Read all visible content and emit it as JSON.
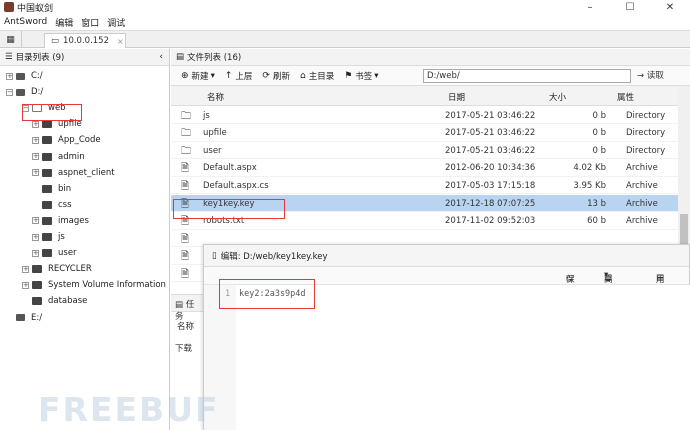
{
  "window": {
    "title": "中国蚁剑",
    "minimize": "–",
    "maximize": "☐",
    "close": "✕"
  },
  "menu": [
    "AntSword",
    "编辑",
    "窗口",
    "调试"
  ],
  "tab": {
    "label": "10.0.0.152",
    "close": "×"
  },
  "tree": {
    "header": "目录列表 (9)",
    "items": [
      {
        "label": "C:/",
        "level": 0,
        "expand": "+"
      },
      {
        "label": "D:/",
        "level": 0,
        "expand": "−"
      },
      {
        "label": "web",
        "level": 1,
        "expand": "−"
      },
      {
        "label": "upfile",
        "level": 2,
        "expand": "+"
      },
      {
        "label": "App_Code",
        "level": 2,
        "expand": "+"
      },
      {
        "label": "admin",
        "level": 2,
        "expand": "+"
      },
      {
        "label": "aspnet_client",
        "level": 2,
        "expand": "+"
      },
      {
        "label": "bin",
        "level": 2,
        "expand": ""
      },
      {
        "label": "css",
        "level": 2,
        "expand": ""
      },
      {
        "label": "images",
        "level": 2,
        "expand": "+"
      },
      {
        "label": "js",
        "level": 2,
        "expand": "+"
      },
      {
        "label": "user",
        "level": 2,
        "expand": "+"
      },
      {
        "label": "RECYCLER",
        "level": 1,
        "expand": "+"
      },
      {
        "label": "System Volume Information",
        "level": 1,
        "expand": "+"
      },
      {
        "label": "database",
        "level": 1,
        "expand": ""
      },
      {
        "label": "E:/",
        "level": 0,
        "expand": ""
      }
    ]
  },
  "files": {
    "header": "文件列表 (16)",
    "toolbar": {
      "new": "新建",
      "up": "上层",
      "refresh": "刷新",
      "home": "主目录",
      "bookmark": "书签",
      "path": "D:/web/",
      "read": "读取"
    },
    "columns": [
      "名称",
      "日期",
      "大小",
      "属性"
    ],
    "rows": [
      {
        "name": "js",
        "date": "2017-05-21 03:46:22",
        "size": "0 b",
        "attr": "Directory",
        "type": "folder"
      },
      {
        "name": "upfile",
        "date": "2017-05-21 03:46:22",
        "size": "0 b",
        "attr": "Directory",
        "type": "folder"
      },
      {
        "name": "user",
        "date": "2017-05-21 03:46:22",
        "size": "0 b",
        "attr": "Directory",
        "type": "folder"
      },
      {
        "name": "Default.aspx",
        "date": "2012-06-20 10:34:36",
        "size": "4.02 Kb",
        "attr": "Archive",
        "type": "file"
      },
      {
        "name": "Default.aspx.cs",
        "date": "2017-05-03 17:15:18",
        "size": "3.95 Kb",
        "attr": "Archive",
        "type": "file"
      },
      {
        "name": "key1key.key",
        "date": "2017-12-18 07:07:25",
        "size": "13 b",
        "attr": "Archive",
        "type": "file"
      },
      {
        "name": "robots.txt",
        "date": "2017-11-02 09:52:03",
        "size": "60 b",
        "attr": "Archive",
        "type": "file"
      }
    ]
  },
  "tasks": {
    "header": "任务",
    "col": "名称",
    "row": "下载"
  },
  "editor": {
    "title": "编辑: D:/web/key1key.key",
    "save": "保存",
    "highlight": "高亮",
    "wrap": "用此编",
    "line_number": "1",
    "content": "key2:2a3s9p4d"
  },
  "watermark": "FREEBUF"
}
